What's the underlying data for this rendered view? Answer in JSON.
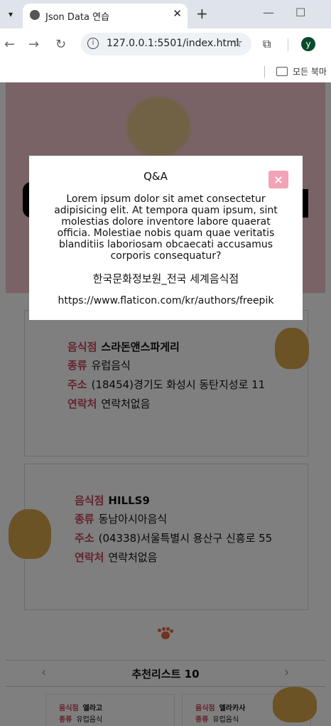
{
  "browser": {
    "tab_title": "Json Data 연습",
    "url": "127.0.0.1:5501/index.html",
    "profile_initial": "y",
    "bookmark_folder": "모든 북마"
  },
  "cards": [
    {
      "name_label": "음식점",
      "name": "스라돈앤스파게리",
      "type_label": "종류",
      "type": "유럽음식",
      "address_label": "주소",
      "address": "(18454)경기도 화성시 동탄지성로 11",
      "contact_label": "연락처",
      "contact": "연락처없음"
    },
    {
      "name_label": "음식점",
      "name": "HILLS9",
      "type_label": "종류",
      "type": "동남아시아음식",
      "address_label": "주소",
      "address": "(04338)서울특별시 용산구 신흥로 55",
      "contact_label": "연락처",
      "contact": "연락처없음"
    }
  ],
  "recommend": {
    "title": "추천리스트 10",
    "prev": "‹",
    "next": "›",
    "items": [
      {
        "name_label": "음식점",
        "name": "엘라고",
        "type_label": "종류",
        "type": "유럽음식"
      },
      {
        "name_label": "음식점",
        "name": "엘라카사",
        "type_label": "종류",
        "type": "유럽음식"
      }
    ]
  },
  "modal": {
    "title": "Q&A",
    "close": "×",
    "body": "Lorem ipsum dolor sit amet consectetur adipisicing elit. At tempora quam ipsum, sint molestias dolore inventore labore quaerat officia. Molestiae nobis quam quae veritatis blanditiis laboriosam obcaecati accusamus corporis consequatur?",
    "credit": "한국문화정보원_전국 세계음식점",
    "link": "https://www.flaticon.com/kr/authors/freepik"
  }
}
